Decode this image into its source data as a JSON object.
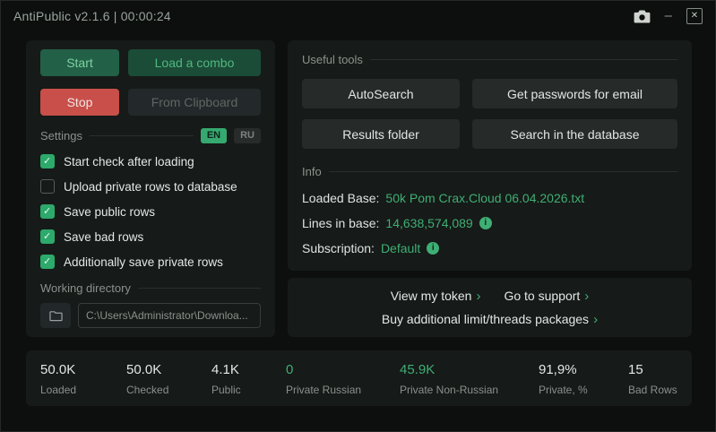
{
  "window": {
    "title": "AntiPublic v2.1.6 | 00:00:24",
    "controls": {
      "minimize": "–",
      "close": "✕"
    }
  },
  "left_panel": {
    "buttons": {
      "start": "Start",
      "load_combo": "Load a combo",
      "stop": "Stop",
      "from_clipboard": "From Clipboard"
    },
    "settings": {
      "label": "Settings",
      "languages": {
        "en": "EN",
        "ru": "RU"
      },
      "checkboxes": [
        {
          "label": "Start check after loading",
          "checked": true
        },
        {
          "label": "Upload private rows to database",
          "checked": false
        },
        {
          "label": "Save public rows",
          "checked": true
        },
        {
          "label": "Save bad rows",
          "checked": true
        },
        {
          "label": "Additionally save private rows",
          "checked": true
        }
      ]
    },
    "working_directory": {
      "label": "Working directory",
      "path": "C:\\Users\\Administrator\\Downloa..."
    }
  },
  "tools_panel": {
    "label": "Useful tools",
    "buttons": {
      "autosearch": "AutoSearch",
      "get_passwords": "Get passwords for email",
      "results_folder": "Results folder",
      "search_database": "Search in the database"
    }
  },
  "info_panel": {
    "label": "Info",
    "loaded_base": {
      "label": "Loaded Base:",
      "value": "50k Pom Crax.Cloud 06.04.2026.txt"
    },
    "lines_in_base": {
      "label": "Lines in base:",
      "value": "14,638,574,089"
    },
    "subscription": {
      "label": "Subscription:",
      "value": "Default"
    },
    "info_icon": "i"
  },
  "links_panel": {
    "view_token": "View my token",
    "go_support": "Go to support",
    "buy_packages": "Buy additional limit/threads packages",
    "chevron": "›"
  },
  "stats": [
    {
      "value": "50.0K",
      "label": "Loaded",
      "accent": false
    },
    {
      "value": "50.0K",
      "label": "Checked",
      "accent": false
    },
    {
      "value": "4.1K",
      "label": "Public",
      "accent": false
    },
    {
      "value": "0",
      "label": "Private Russian",
      "accent": true
    },
    {
      "value": "45.9K",
      "label": "Private Non-Russian",
      "accent": true
    },
    {
      "value": "91,9%",
      "label": "Private, %",
      "accent": false
    },
    {
      "value": "15",
      "label": "Bad Rows",
      "accent": false
    }
  ],
  "colors": {
    "accent_green": "#3fae74",
    "danger_red": "#c84f4a",
    "card_bg": "#161a18",
    "window_bg": "#0c0f0d"
  }
}
